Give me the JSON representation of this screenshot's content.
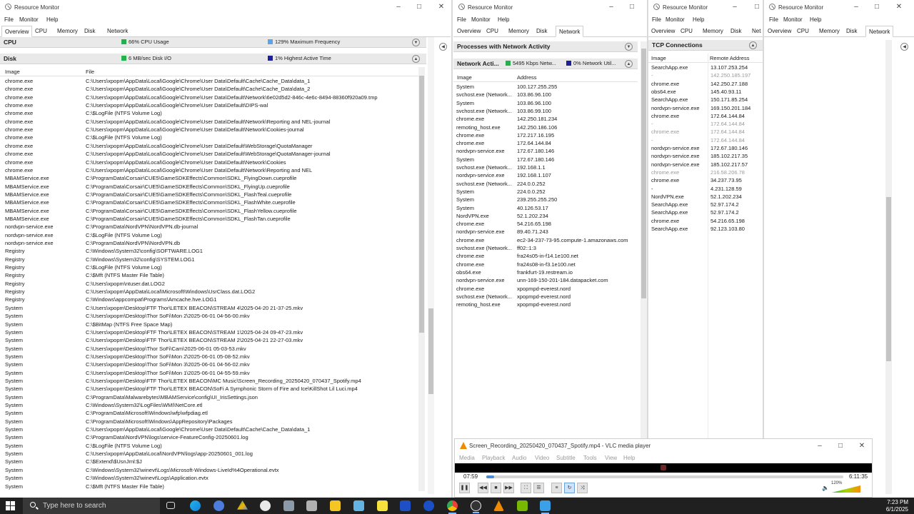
{
  "windows": {
    "w1": {
      "title": "Resource Monitor",
      "menu": [
        "File",
        "Monitor",
        "Help"
      ],
      "tabs": [
        "Overview",
        "CPU",
        "Memory",
        "Disk",
        "Network"
      ],
      "cpu": {
        "title": "CPU",
        "usage": "66% CPU Usage",
        "freq": "129% Maximum Frequency"
      },
      "disk": {
        "title": "Disk",
        "io": "6 MB/sec Disk I/O",
        "active": "1% Highest Active Time"
      },
      "columns": [
        "Image",
        "File"
      ],
      "rows": [
        [
          "chrome.exe",
          "C:\\Users\\xpopm\\AppData\\Local\\Google\\Chrome\\User Data\\Default\\Cache\\Cache_Data\\data_1"
        ],
        [
          "chrome.exe",
          "C:\\Users\\xpopm\\AppData\\Local\\Google\\Chrome\\User Data\\Default\\Cache\\Cache_Data\\data_2"
        ],
        [
          "chrome.exe",
          "C:\\Users\\xpopm\\AppData\\Local\\Google\\Chrome\\User Data\\Default\\Network\\6e02d5d2-846c-4e6c-8494-88360f920a09.tmp"
        ],
        [
          "chrome.exe",
          "C:\\Users\\xpopm\\AppData\\Local\\Google\\Chrome\\User Data\\Default\\DIPS-wal"
        ],
        [
          "chrome.exe",
          "C:\\$LogFile (NTFS Volume Log)"
        ],
        [
          "chrome.exe",
          "C:\\Users\\xpopm\\AppData\\Local\\Google\\Chrome\\User Data\\Default\\Network\\Reporting and NEL-journal"
        ],
        [
          "chrome.exe",
          "C:\\Users\\xpopm\\AppData\\Local\\Google\\Chrome\\User Data\\Default\\Network\\Cookies-journal"
        ],
        [
          "chrome.exe",
          "C:\\$LogFile (NTFS Volume Log)"
        ],
        [
          "chrome.exe",
          "C:\\Users\\xpopm\\AppData\\Local\\Google\\Chrome\\User Data\\Default\\WebStorage\\QuotaManager"
        ],
        [
          "chrome.exe",
          "C:\\Users\\xpopm\\AppData\\Local\\Google\\Chrome\\User Data\\Default\\WebStorage\\QuotaManager-journal"
        ],
        [
          "chrome.exe",
          "C:\\Users\\xpopm\\AppData\\Local\\Google\\Chrome\\User Data\\Default\\Network\\Cookies"
        ],
        [
          "chrome.exe",
          "C:\\Users\\xpopm\\AppData\\Local\\Google\\Chrome\\User Data\\Default\\Network\\Reporting and NEL"
        ],
        [
          "MBAMService.exe",
          "C:\\ProgramData\\Corsair\\CUE5\\GameSDKEffects\\Common\\SDKL_FlyingDown.cueprofile"
        ],
        [
          "MBAMService.exe",
          "C:\\ProgramData\\Corsair\\CUE5\\GameSDKEffects\\Common\\SDKL_FlyingUp.cueprofile"
        ],
        [
          "MBAMService.exe",
          "C:\\ProgramData\\Corsair\\CUE5\\GameSDKEffects\\Common\\SDKL_FlashTeal.cueprofile"
        ],
        [
          "MBAMService.exe",
          "C:\\ProgramData\\Corsair\\CUE5\\GameSDKEffects\\Common\\SDKL_FlashWhite.cueprofile"
        ],
        [
          "MBAMService.exe",
          "C:\\ProgramData\\Corsair\\CUE5\\GameSDKEffects\\Common\\SDKL_FlashYellow.cueprofile"
        ],
        [
          "MBAMService.exe",
          "C:\\ProgramData\\Corsair\\CUE5\\GameSDKEffects\\Common\\SDKL_FlashTan.cueprofile"
        ],
        [
          "nordvpn-service.exe",
          "C:\\ProgramData\\NordVPN\\NordVPN.db-journal"
        ],
        [
          "nordvpn-service.exe",
          "C:\\$LogFile (NTFS Volume Log)"
        ],
        [
          "nordvpn-service.exe",
          "C:\\ProgramData\\NordVPN\\NordVPN.db"
        ],
        [
          "Registry",
          "C:\\Windows\\System32\\config\\SOFTWARE.LOG1"
        ],
        [
          "Registry",
          "C:\\Windows\\System32\\config\\SYSTEM.LOG1"
        ],
        [
          "Registry",
          "C:\\$LogFile (NTFS Volume Log)"
        ],
        [
          "Registry",
          "C:\\$Mft (NTFS Master File Table)"
        ],
        [
          "Registry",
          "C:\\Users\\xpopm\\ntuser.dat.LOG2"
        ],
        [
          "Registry",
          "C:\\Users\\xpopm\\AppData\\Local\\Microsoft\\Windows\\UsrClass.dat.LOG2"
        ],
        [
          "Registry",
          "C:\\Windows\\appcompat\\Programs\\Amcache.hve.LOG1"
        ],
        [
          "System",
          "C:\\Users\\xpopm\\Desktop\\FTF Thor\\LETEX BEACON\\STREAM 4\\2025-04-20 21-37-25.mkv"
        ],
        [
          "System",
          "C:\\Users\\xpopm\\Desktop\\Thor SoFi\\Mon 2\\2025-06-01 04-56-00.mkv"
        ],
        [
          "System",
          "C:\\$BitMap (NTFS Free Space Map)"
        ],
        [
          "System",
          "C:\\Users\\xpopm\\Desktop\\FTF Thor\\LETEX BEACON\\STREAM 1\\2025-04-24 09-47-23.mkv"
        ],
        [
          "System",
          "C:\\Users\\xpopm\\Desktop\\FTF Thor\\LETEX BEACON\\STREAM 2\\2025-04-21 22-27-03.mkv"
        ],
        [
          "System",
          "C:\\Users\\xpopm\\Desktop\\Thor SoFi\\Cam\\2025-06-01 05-03-53.mkv"
        ],
        [
          "System",
          "C:\\Users\\xpopm\\Desktop\\Thor SoFi\\Mon 2\\2025-06-01 05-08-52.mkv"
        ],
        [
          "System",
          "C:\\Users\\xpopm\\Desktop\\Thor SoFi\\Mon 3\\2025-06-01 04-56-02.mkv"
        ],
        [
          "System",
          "C:\\Users\\xpopm\\Desktop\\Thor SoFi\\Mon 1\\2025-06-01 04-55-59.mkv"
        ],
        [
          "System",
          "C:\\Users\\xpopm\\Desktop\\FTF Thor\\LETEX BEACON\\MC Music\\Screen_Recording_20250420_070437_Spotify.mp4"
        ],
        [
          "System",
          "C:\\Users\\xpopm\\Desktop\\FTF Thor\\LETEX BEACON\\SoFi A Symphonic Storm of Fire and Ice\\KillShot Lil Luci.mp4"
        ],
        [
          "System",
          "C:\\ProgramData\\Malwarebytes\\MBAMService\\config\\UI_IrisSettings.json"
        ],
        [
          "System",
          "C:\\Windows\\System32\\LogFiles\\WMI\\NetCore.etl"
        ],
        [
          "System",
          "C:\\ProgramData\\Microsoft\\Windows\\wfp\\wfpdiag.etl"
        ],
        [
          "System",
          "C:\\ProgramData\\Microsoft\\Windows\\AppRepository\\Packages"
        ],
        [
          "System",
          "C:\\Users\\xpopm\\AppData\\Local\\Google\\Chrome\\User Data\\Default\\Cache\\Cache_Data\\data_1"
        ],
        [
          "System",
          "C:\\ProgramData\\NordVPN\\logs\\service-FeatureConfig-20250601.log"
        ],
        [
          "System",
          "C:\\$LogFile (NTFS Volume Log)"
        ],
        [
          "System",
          "C:\\Users\\xpopm\\AppData\\Local\\NordVPN\\logs\\app-20250601_001.log"
        ],
        [
          "System",
          "C:\\$Extend\\$UsnJrnl:$J"
        ],
        [
          "System",
          "C:\\Windows\\System32\\winevt\\Logs\\Microsoft-Windows-LiveId%4Operational.evtx"
        ],
        [
          "System",
          "C:\\Windows\\System32\\winevt\\Logs\\Application.evtx"
        ],
        [
          "System",
          "C:\\$Mft (NTFS Master File Table)"
        ]
      ]
    },
    "w2": {
      "title": "Resource Monitor",
      "menu": [
        "File",
        "Monitor",
        "Help"
      ],
      "tabs": [
        "Overview",
        "CPU",
        "Memory",
        "Disk",
        "Network"
      ],
      "procs_title": "Processes with Network Activity",
      "net": {
        "title": "Network Acti...",
        "kbps": "5495 Kbps Netw...",
        "util": "0% Network Util..."
      },
      "columns": [
        "Image",
        "Address"
      ],
      "rows": [
        [
          "System",
          "100.127.255.255"
        ],
        [
          "svchost.exe (Network...",
          "103.86.96.100"
        ],
        [
          "System",
          "103.86.96.100"
        ],
        [
          "svchost.exe (Network...",
          "103.86.99.100"
        ],
        [
          "chrome.exe",
          "142.250.181.234"
        ],
        [
          "remoting_host.exe",
          "142.250.186.106"
        ],
        [
          "chrome.exe",
          "172.217.16.195"
        ],
        [
          "chrome.exe",
          "172.64.144.84"
        ],
        [
          "nordvpn-service.exe",
          "172.67.180.146"
        ],
        [
          "System",
          "172.67.180.146"
        ],
        [
          "svchost.exe (Network...",
          "192.168.1.1"
        ],
        [
          "nordvpn-service.exe",
          "192.168.1.107"
        ],
        [
          "svchost.exe (Network...",
          "224.0.0.252"
        ],
        [
          "System",
          "224.0.0.252"
        ],
        [
          "System",
          "239.255.255.250"
        ],
        [
          "System",
          "40.126.53.17"
        ],
        [
          "NordVPN.exe",
          "52.1.202.234"
        ],
        [
          "chrome.exe",
          "54.216.65.198"
        ],
        [
          "nordvpn-service.exe",
          "89.40.71.243"
        ],
        [
          "chrome.exe",
          "ec2-34-237-73-95.compute-1.amazonaws.com"
        ],
        [
          "svchost.exe (Network...",
          "ff02::1:3"
        ],
        [
          "chrome.exe",
          "fra24s05-in-f14.1e100.net"
        ],
        [
          "chrome.exe",
          "fra24s08-in-f3.1e100.net"
        ],
        [
          "obs64.exe",
          "frankfurt-19.restream.io"
        ],
        [
          "nordvpn-service.exe",
          "unn-169-150-201-184.datapacket.com"
        ],
        [
          "chrome.exe",
          "xpopmpd-everest.nord"
        ],
        [
          "svchost.exe (Network...",
          "xpopmpd-everest.nord"
        ],
        [
          "remoting_host.exe",
          "xpopmpd-everest.nord"
        ]
      ]
    },
    "w3": {
      "title": "Resource Monitor",
      "menu": [
        "File",
        "Monitor",
        "Help"
      ],
      "tabs": [
        "Overview",
        "CPU",
        "Memory",
        "Disk",
        "Net"
      ],
      "tcp_title": "TCP Connections",
      "columns": [
        "Image",
        "Remote Address"
      ],
      "rows": [
        [
          "SearchApp.exe",
          "13.107.253.254",
          false
        ],
        [
          "-",
          "142.250.185.197",
          true
        ],
        [
          "chrome.exe",
          "142.250.27.188",
          false
        ],
        [
          "obs64.exe",
          "145.40.93.11",
          false
        ],
        [
          "SearchApp.exe",
          "150.171.85.254",
          false
        ],
        [
          "nordvpn-service.exe",
          "169.150.201.184",
          false
        ],
        [
          "chrome.exe",
          "172.64.144.84",
          false
        ],
        [
          "-",
          "172.64.144.84",
          true
        ],
        [
          "chrome.exe",
          "172.64.144.84",
          true
        ],
        [
          "-",
          "172.64.144.84",
          true
        ],
        [
          "nordvpn-service.exe",
          "172.67.180.146",
          false
        ],
        [
          "nordvpn-service.exe",
          "185.102.217.35",
          false
        ],
        [
          "nordvpn-service.exe",
          "185.102.217.57",
          false
        ],
        [
          "chrome.exe",
          "216.58.206.78",
          true
        ],
        [
          "chrome.exe",
          "34.237.73.95",
          false
        ],
        [
          "-",
          "4.231.128.59",
          false
        ],
        [
          "NordVPN.exe",
          "52.1.202.234",
          false
        ],
        [
          "SearchApp.exe",
          "52.97.174.2",
          false
        ],
        [
          "SearchApp.exe",
          "52.97.174.2",
          false
        ],
        [
          "chrome.exe",
          "54.216.65.198",
          false
        ],
        [
          "SearchApp.exe",
          "92.123.103.80",
          false
        ]
      ]
    },
    "w4": {
      "title": "Resource Monitor",
      "menu": [
        "File",
        "Monitor",
        "Help"
      ],
      "tabs": [
        "Overview",
        "CPU",
        "Memory",
        "Disk",
        "Network"
      ]
    }
  },
  "vlc": {
    "title": "Screen_Recording_20250420_070437_Spotify.mp4 - VLC media player",
    "menu": [
      "Media",
      "Playback",
      "Audio",
      "Video",
      "Subtitle",
      "Tools",
      "View",
      "Help"
    ],
    "elapsed": "07:59",
    "total": "6:11:35",
    "progress": 0.022,
    "volume": "120%"
  },
  "taskbar": {
    "search_placeholder": "Type here to search",
    "time": "7:23 PM",
    "date": "6/1/2025"
  },
  "colors": {
    "cpu_indicator": "#22b14c",
    "freq_indicator": "#5ea3e6",
    "disk_indicator": "#22b14c",
    "disk_active": "#1f1f9c",
    "net_indicator": "#22b14c",
    "net_util": "#1f1f9c"
  }
}
